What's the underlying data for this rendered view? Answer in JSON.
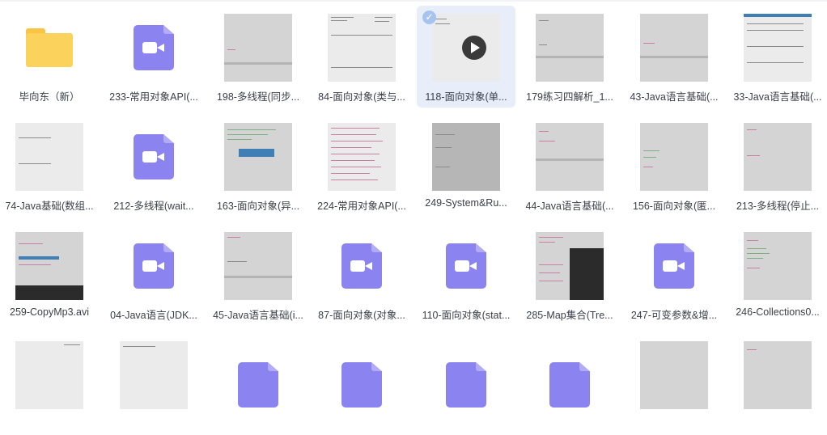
{
  "files": [
    {
      "name": "毕向东（新）",
      "kind": "folder"
    },
    {
      "name": "233-常用对象API(...",
      "kind": "video-icon"
    },
    {
      "name": "198-多线程(同步...",
      "kind": "screenshot"
    },
    {
      "name": "84-面向对象(类与...",
      "kind": "screenshot"
    },
    {
      "name": "118-面向对象(单...",
      "kind": "video-thumb",
      "selected": true
    },
    {
      "name": "179练习四解析_1...",
      "kind": "screenshot"
    },
    {
      "name": "43-Java语言基础(...",
      "kind": "screenshot"
    },
    {
      "name": "33-Java语言基础(...",
      "kind": "screenshot"
    },
    {
      "name": "74-Java基础(数组...",
      "kind": "screenshot"
    },
    {
      "name": "212-多线程(wait...",
      "kind": "video-icon"
    },
    {
      "name": "163-面向对象(异...",
      "kind": "screenshot"
    },
    {
      "name": "224-常用对象API(...",
      "kind": "screenshot"
    },
    {
      "name": "249-System&Ru...",
      "kind": "screenshot"
    },
    {
      "name": "44-Java语言基础(...",
      "kind": "screenshot"
    },
    {
      "name": "156-面向对象(匿...",
      "kind": "screenshot"
    },
    {
      "name": "213-多线程(停止...",
      "kind": "screenshot"
    },
    {
      "name": "259-CopyMp3.avi",
      "kind": "screenshot"
    },
    {
      "name": "04-Java语言(JDK...",
      "kind": "video-icon"
    },
    {
      "name": "45-Java语言基础(i...",
      "kind": "screenshot"
    },
    {
      "name": "87-面向对象(对象...",
      "kind": "video-icon"
    },
    {
      "name": "110-面向对象(stat...",
      "kind": "video-icon"
    },
    {
      "name": "285-Map集合(Tre...",
      "kind": "screenshot"
    },
    {
      "name": "247-可变参数&增...",
      "kind": "video-icon"
    },
    {
      "name": "246-Collections0...",
      "kind": "screenshot"
    }
  ],
  "colors": {
    "folder": "#fbd25b",
    "video_icon": "#8b83ef",
    "selected_bg": "#e8eef9",
    "check": "#a7c3ef"
  }
}
